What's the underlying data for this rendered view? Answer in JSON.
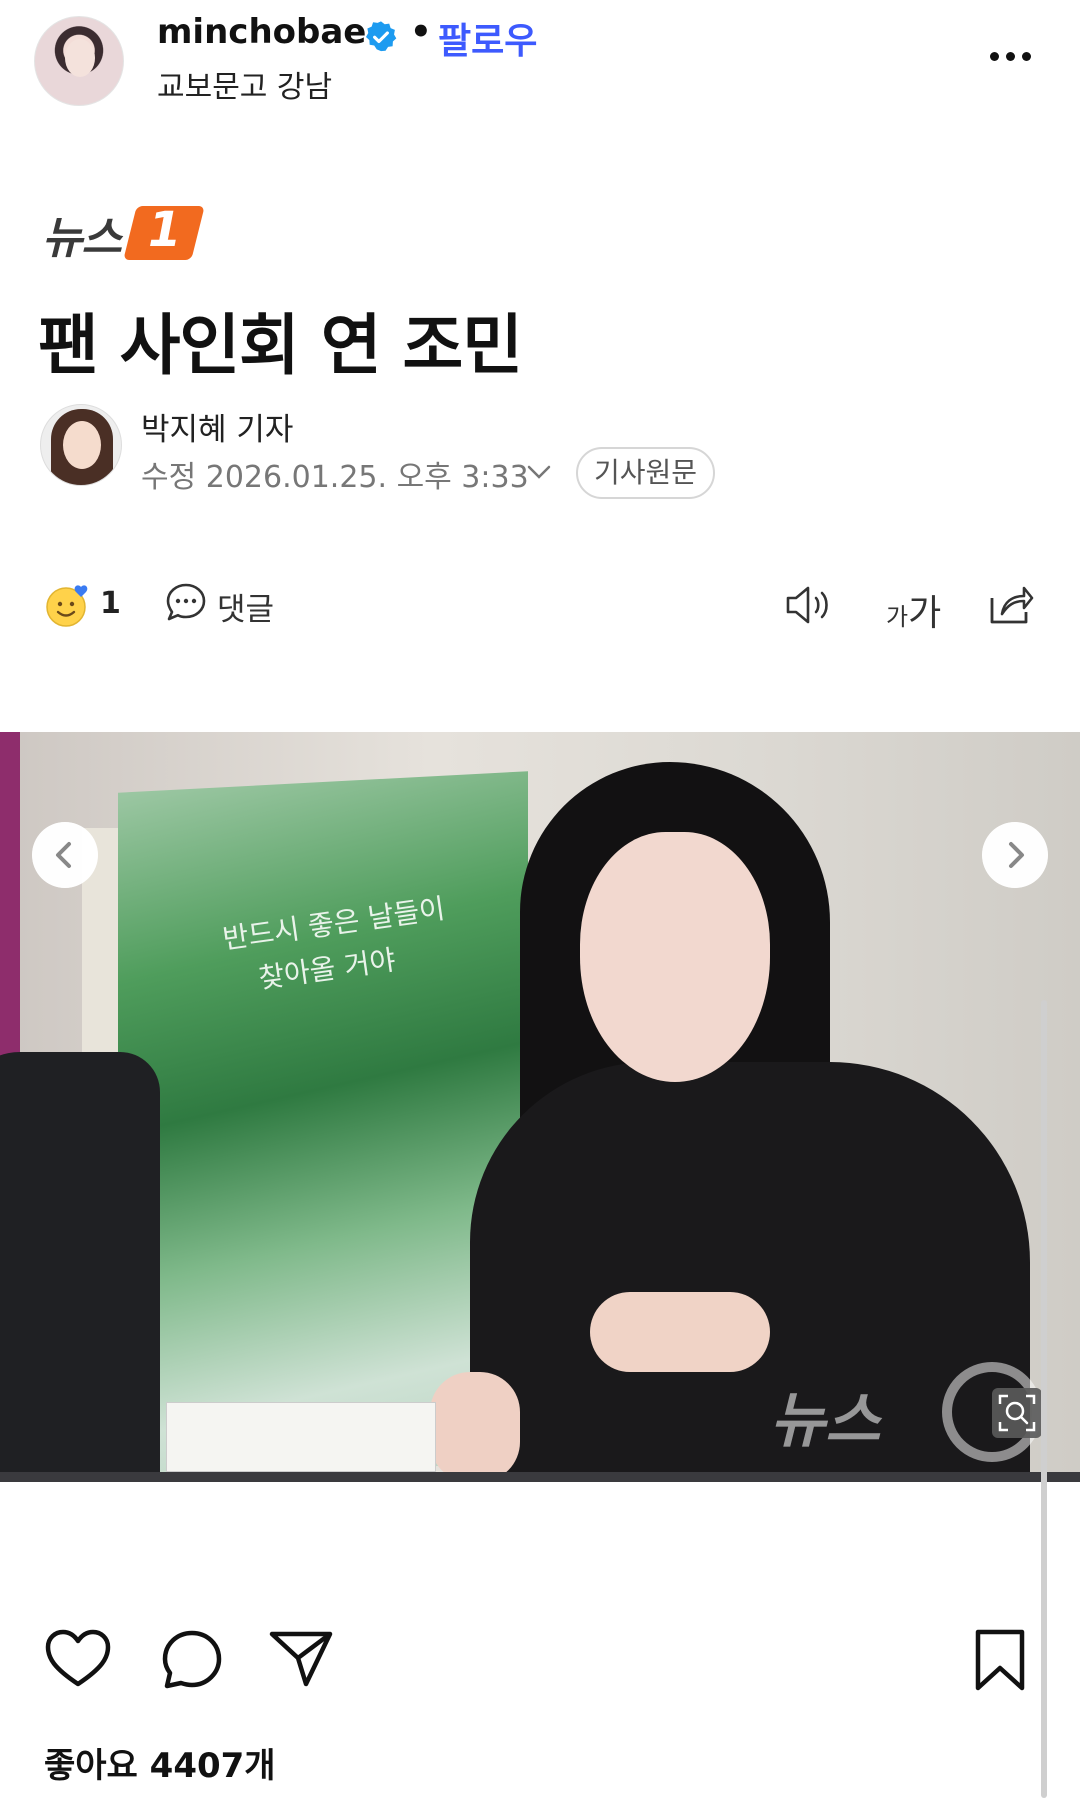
{
  "post": {
    "username": "minchobae",
    "separator": "•",
    "follow_label": "팔로우",
    "location": "교보문고 강남"
  },
  "article": {
    "logo_text": "뉴스",
    "logo_badge": "1",
    "title": "팬 사인회 연 조민",
    "reporter": "박지혜 기자",
    "modified": "수정 2026.01.25. 오후 3:33",
    "source_label": "기사원문"
  },
  "actions": {
    "reaction_count": "1",
    "comment_label": "댓글",
    "fontsize_small": "가",
    "fontsize_large": "가"
  },
  "photo": {
    "poster_line1": "반드시 좋은 날들이",
    "poster_line2": "찾아올 거야",
    "watermark": "뉴스"
  },
  "footer": {
    "likes": "좋아요 4407개"
  },
  "colors": {
    "follow": "#3d5afe",
    "verified": "#1d9bf0",
    "news_orange": "#f26a1f"
  }
}
